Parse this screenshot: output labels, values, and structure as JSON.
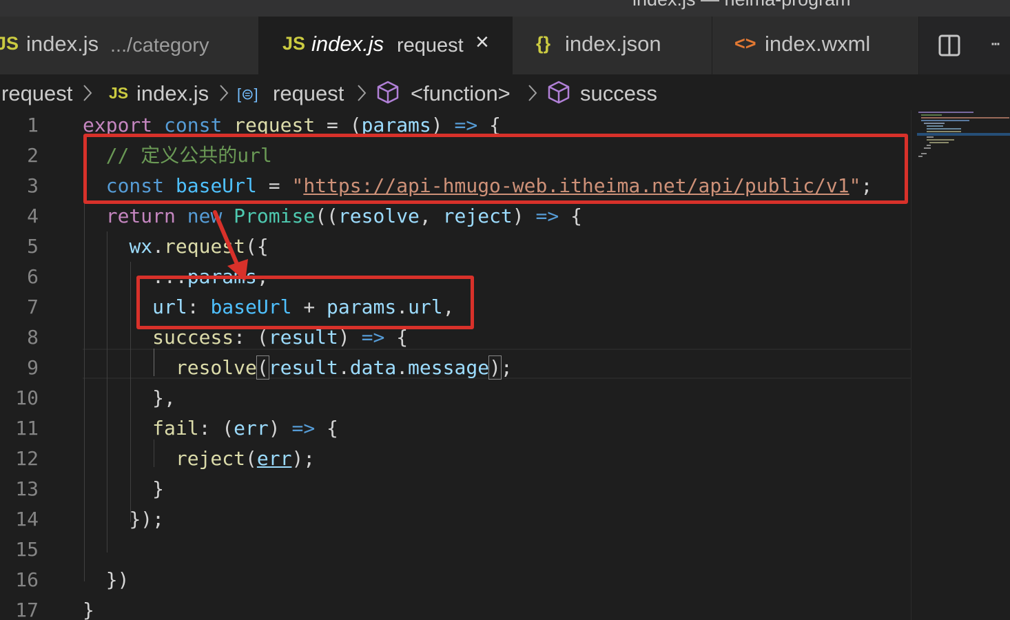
{
  "window": {
    "title": "index.js — heima-program"
  },
  "tabs": [
    {
      "icon": "JS",
      "name": "index.js",
      "desc": ".../category",
      "active": false
    },
    {
      "icon": "JS",
      "name": "index.js",
      "desc": "request",
      "active": true,
      "close": "×"
    },
    {
      "icon": "{}",
      "name": "index.json",
      "active": false
    },
    {
      "icon": "<>",
      "name": "index.wxml",
      "active": false
    }
  ],
  "toolbar": {
    "more_label": "···"
  },
  "breadcrumb": [
    {
      "label": "request"
    },
    {
      "icon": "JS",
      "label": "index.js"
    },
    {
      "icon": "[⊜]",
      "label": "request"
    },
    {
      "label": "<function>"
    },
    {
      "label": "success"
    }
  ],
  "code": {
    "lines": [
      [
        [
          "kw",
          "export"
        ],
        [
          "pn",
          " "
        ],
        [
          "st",
          "const"
        ],
        [
          "pn",
          " "
        ],
        [
          "fn",
          "request"
        ],
        [
          "pn",
          " = ("
        ],
        [
          "vr",
          "params"
        ],
        [
          "pn",
          ") "
        ],
        [
          "st",
          "=>"
        ],
        [
          "pn",
          " {"
        ]
      ],
      [
        [
          "pn",
          "  "
        ],
        [
          "cm",
          "// 定义公共的url"
        ]
      ],
      [
        [
          "pn",
          "  "
        ],
        [
          "st",
          "const"
        ],
        [
          "pn",
          " "
        ],
        [
          "cn",
          "baseUrl"
        ],
        [
          "pn",
          " = "
        ],
        [
          "str",
          "\""
        ],
        [
          "strurl",
          "https://api-hmugo-web.itheima.net/api/public/v1"
        ],
        [
          "str",
          "\""
        ],
        [
          "pn",
          ";"
        ]
      ],
      [
        [
          "pn",
          "  "
        ],
        [
          "kw",
          "return"
        ],
        [
          "pn",
          " "
        ],
        [
          "st",
          "new"
        ],
        [
          "pn",
          " "
        ],
        [
          "cls",
          "Promise"
        ],
        [
          "pn",
          "(("
        ],
        [
          "vr",
          "resolve"
        ],
        [
          "pn",
          ", "
        ],
        [
          "vr",
          "reject"
        ],
        [
          "pn",
          ") "
        ],
        [
          "st",
          "=>"
        ],
        [
          "pn",
          " {"
        ]
      ],
      [
        [
          "pn",
          "    "
        ],
        [
          "vr",
          "wx"
        ],
        [
          "pn",
          "."
        ],
        [
          "fn",
          "request"
        ],
        [
          "pn",
          "({"
        ]
      ],
      [
        [
          "pn",
          "      "
        ],
        [
          "pn",
          "..."
        ],
        [
          "vr",
          "params"
        ],
        [
          "pn",
          ","
        ]
      ],
      [
        [
          "pn",
          "      "
        ],
        [
          "vr",
          "url"
        ],
        [
          "pn",
          ": "
        ],
        [
          "cn",
          "baseUrl"
        ],
        [
          "pn",
          " + "
        ],
        [
          "vr",
          "params"
        ],
        [
          "pn",
          "."
        ],
        [
          "vr",
          "url"
        ],
        [
          "pn",
          ","
        ]
      ],
      [
        [
          "pn",
          "      "
        ],
        [
          "fn",
          "success"
        ],
        [
          "pn",
          ": ("
        ],
        [
          "vr",
          "result"
        ],
        [
          "pn",
          ") "
        ],
        [
          "st",
          "=>"
        ],
        [
          "pn",
          " {"
        ]
      ],
      [
        [
          "pn",
          "        "
        ],
        [
          "fn",
          "resolve"
        ],
        [
          "pnb",
          "("
        ],
        [
          "vr",
          "result"
        ],
        [
          "pn",
          "."
        ],
        [
          "vr",
          "data"
        ],
        [
          "pn",
          "."
        ],
        [
          "vr",
          "message"
        ],
        [
          "pnb",
          ")"
        ],
        [
          "pn",
          ";"
        ]
      ],
      [
        [
          "pn",
          "      "
        ],
        [
          "pn",
          "},"
        ]
      ],
      [
        [
          "pn",
          "      "
        ],
        [
          "fn",
          "fail"
        ],
        [
          "pn",
          ": ("
        ],
        [
          "vr",
          "err"
        ],
        [
          "pn",
          ") "
        ],
        [
          "st",
          "=>"
        ],
        [
          "pn",
          " {"
        ]
      ],
      [
        [
          "pn",
          "        "
        ],
        [
          "fn",
          "reject"
        ],
        [
          "pn",
          "("
        ],
        [
          "vrurl",
          "err"
        ],
        [
          "pn",
          ");"
        ]
      ],
      [
        [
          "pn",
          "      "
        ],
        [
          "pn",
          "}"
        ]
      ],
      [
        [
          "pn",
          "    "
        ],
        [
          "pn",
          "});"
        ]
      ],
      [
        [
          "pn",
          ""
        ]
      ],
      [
        [
          "pn",
          "  "
        ],
        [
          "pn",
          "})"
        ]
      ],
      [
        [
          "pn",
          "}"
        ]
      ]
    ],
    "line_numbers": [
      "1",
      "2",
      "3",
      "4",
      "5",
      "6",
      "7",
      "8",
      "9",
      "10",
      "11",
      "12",
      "13",
      "14",
      "15",
      "16",
      "17"
    ]
  },
  "colors": {
    "accent_annotation": "#d8312a",
    "js_icon": "#cbcb41",
    "json_icon": "#cbcb41",
    "wxml_icon": "#e37933",
    "symbol_icon": "#b180d7"
  }
}
